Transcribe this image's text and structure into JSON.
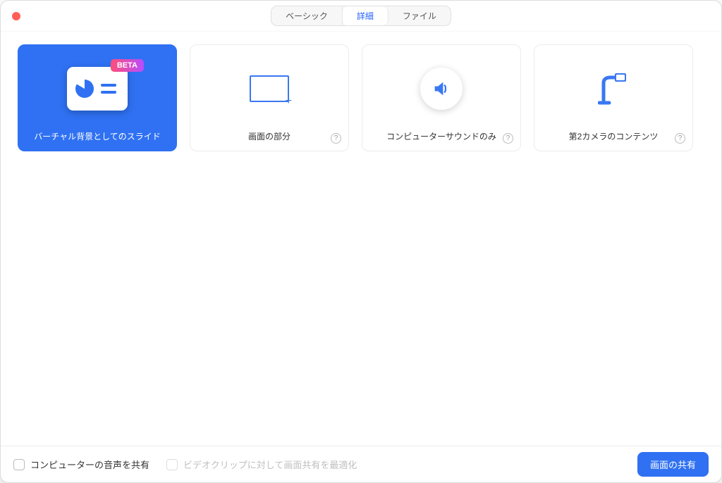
{
  "tabs": {
    "basic": "ベーシック",
    "advanced": "詳細",
    "file": "ファイル"
  },
  "cards": {
    "virtual_bg_slide": {
      "label": "バーチャル背景としてのスライド",
      "badge": "BETA"
    },
    "screen_portion": {
      "label": "画面の部分"
    },
    "computer_sound": {
      "label": "コンピューターサウンドのみ"
    },
    "second_camera": {
      "label": "第2カメラのコンテンツ"
    }
  },
  "footer": {
    "share_computer_audio": "コンピューターの音声を共有",
    "optimize_video_clip": "ビデオクリップに対して画面共有を最適化",
    "share_button": "画面の共有"
  }
}
